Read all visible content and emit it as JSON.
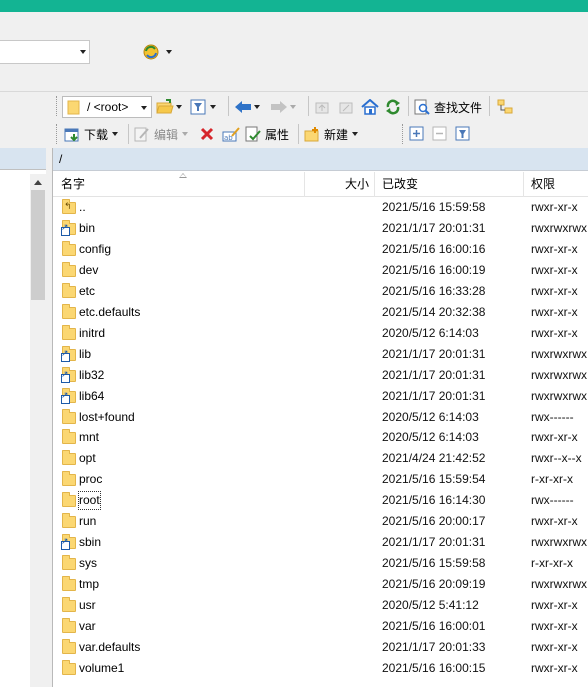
{
  "colors": {
    "titlebar": "#13b493",
    "pane_header": "#d8e4f0",
    "folder": "#fbd772"
  },
  "toolbar1": {
    "path_value": "/ <root>",
    "find_files_label": "查找文件",
    "icons": [
      "folder-open-icon",
      "filter-icon",
      "back-arrow-icon",
      "forward-arrow-icon",
      "parent-dir-icon",
      "root-dir-icon",
      "home-icon",
      "refresh-icon",
      "find-files-icon",
      "tree-toggle-icon"
    ]
  },
  "toolbar2": {
    "download_label": "下载",
    "edit_label": "编辑",
    "properties_label": "属性",
    "new_label": "新建",
    "icons": [
      "download-icon",
      "edit-icon",
      "delete-icon",
      "rename-icon",
      "properties-icon",
      "new-icon",
      "expand-icon",
      "collapse-icon",
      "filter-icon"
    ]
  },
  "remote_path": "/",
  "columns": {
    "name": "名字",
    "size": "大小",
    "modified": "已改变",
    "permissions": "权限"
  },
  "files": [
    {
      "name": "..",
      "type": "parent",
      "modified": "2021/5/16 15:59:58",
      "perm": "rwxr-xr-x"
    },
    {
      "name": "bin",
      "type": "link",
      "modified": "2021/1/17 20:01:31",
      "perm": "rwxrwxrwx"
    },
    {
      "name": "config",
      "type": "folder",
      "modified": "2021/5/16 16:00:16",
      "perm": "rwxr-xr-x"
    },
    {
      "name": "dev",
      "type": "folder",
      "modified": "2021/5/16 16:00:19",
      "perm": "rwxr-xr-x"
    },
    {
      "name": "etc",
      "type": "folder",
      "modified": "2021/5/16 16:33:28",
      "perm": "rwxr-xr-x"
    },
    {
      "name": "etc.defaults",
      "type": "folder",
      "modified": "2021/5/14 20:32:38",
      "perm": "rwxr-xr-x"
    },
    {
      "name": "initrd",
      "type": "folder",
      "modified": "2020/5/12 6:14:03",
      "perm": "rwxr-xr-x"
    },
    {
      "name": "lib",
      "type": "link",
      "modified": "2021/1/17 20:01:31",
      "perm": "rwxrwxrwx"
    },
    {
      "name": "lib32",
      "type": "link",
      "modified": "2021/1/17 20:01:31",
      "perm": "rwxrwxrwx"
    },
    {
      "name": "lib64",
      "type": "link",
      "modified": "2021/1/17 20:01:31",
      "perm": "rwxrwxrwx"
    },
    {
      "name": "lost+found",
      "type": "folder",
      "modified": "2020/5/12 6:14:03",
      "perm": "rwx------"
    },
    {
      "name": "mnt",
      "type": "folder",
      "modified": "2020/5/12 6:14:03",
      "perm": "rwxr-xr-x"
    },
    {
      "name": "opt",
      "type": "folder",
      "modified": "2021/4/24 21:42:52",
      "perm": "rwxr--x--x"
    },
    {
      "name": "proc",
      "type": "folder",
      "modified": "2021/5/16 15:59:54",
      "perm": "r-xr-xr-x"
    },
    {
      "name": "root",
      "type": "folder",
      "modified": "2021/5/16 16:14:30",
      "perm": "rwx------",
      "focused": true
    },
    {
      "name": "run",
      "type": "folder",
      "modified": "2021/5/16 20:00:17",
      "perm": "rwxr-xr-x"
    },
    {
      "name": "sbin",
      "type": "link",
      "modified": "2021/1/17 20:01:31",
      "perm": "rwxrwxrwx"
    },
    {
      "name": "sys",
      "type": "folder",
      "modified": "2021/5/16 15:59:58",
      "perm": "r-xr-xr-x"
    },
    {
      "name": "tmp",
      "type": "folder",
      "modified": "2021/5/16 20:09:19",
      "perm": "rwxrwxrwx"
    },
    {
      "name": "usr",
      "type": "folder",
      "modified": "2020/5/12 5:41:12",
      "perm": "rwxr-xr-x"
    },
    {
      "name": "var",
      "type": "folder",
      "modified": "2021/5/16 16:00:01",
      "perm": "rwxr-xr-x"
    },
    {
      "name": "var.defaults",
      "type": "folder",
      "modified": "2021/1/17 20:01:33",
      "perm": "rwxr-xr-x"
    },
    {
      "name": "volume1",
      "type": "folder",
      "modified": "2021/5/16 16:00:15",
      "perm": "rwxr-xr-x"
    }
  ]
}
